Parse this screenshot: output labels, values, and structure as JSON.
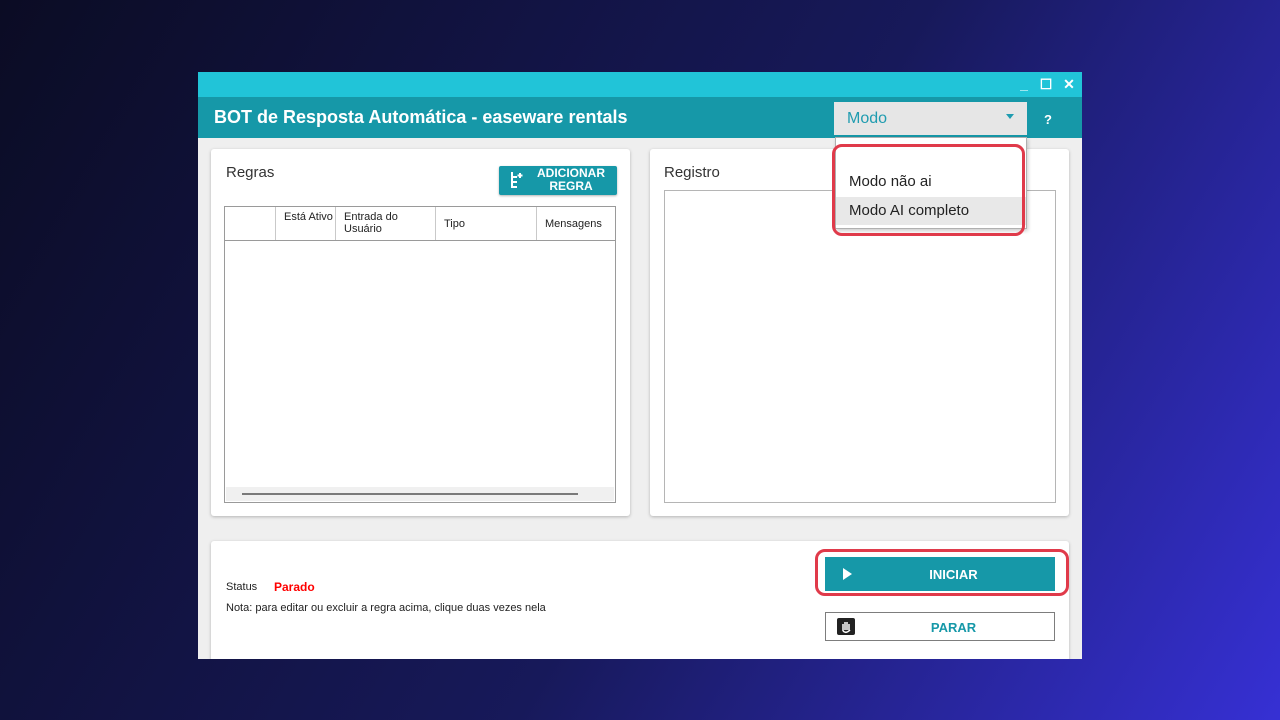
{
  "window": {
    "title": "BOT de Resposta Automática - easeware rentals",
    "controls": {
      "minimize": "_",
      "maximize": "☐",
      "close": "✕"
    },
    "help": "?"
  },
  "mode": {
    "selected": "Modo",
    "options": [
      "Modo não ai",
      "Modo AI completo"
    ],
    "highlighted_index": 1
  },
  "rules": {
    "title": "Regras",
    "add_button": "ADICIONAR REGRA",
    "columns": [
      "",
      "Está Ativo",
      "Entrada do Usuário",
      "Tipo",
      "Mensagens"
    ],
    "rows": []
  },
  "log": {
    "title": "Registro"
  },
  "status": {
    "label": "Status",
    "value": "Parado",
    "note": "Nota: para editar ou excluir a regra acima, clique duas vezes nela"
  },
  "actions": {
    "start": "INICIAR",
    "stop": "PARAR"
  },
  "colors": {
    "accent": "#1698a8",
    "titlebar": "#21c4d8",
    "status_stopped": "#ff0000",
    "highlight": "#e03a4a"
  }
}
